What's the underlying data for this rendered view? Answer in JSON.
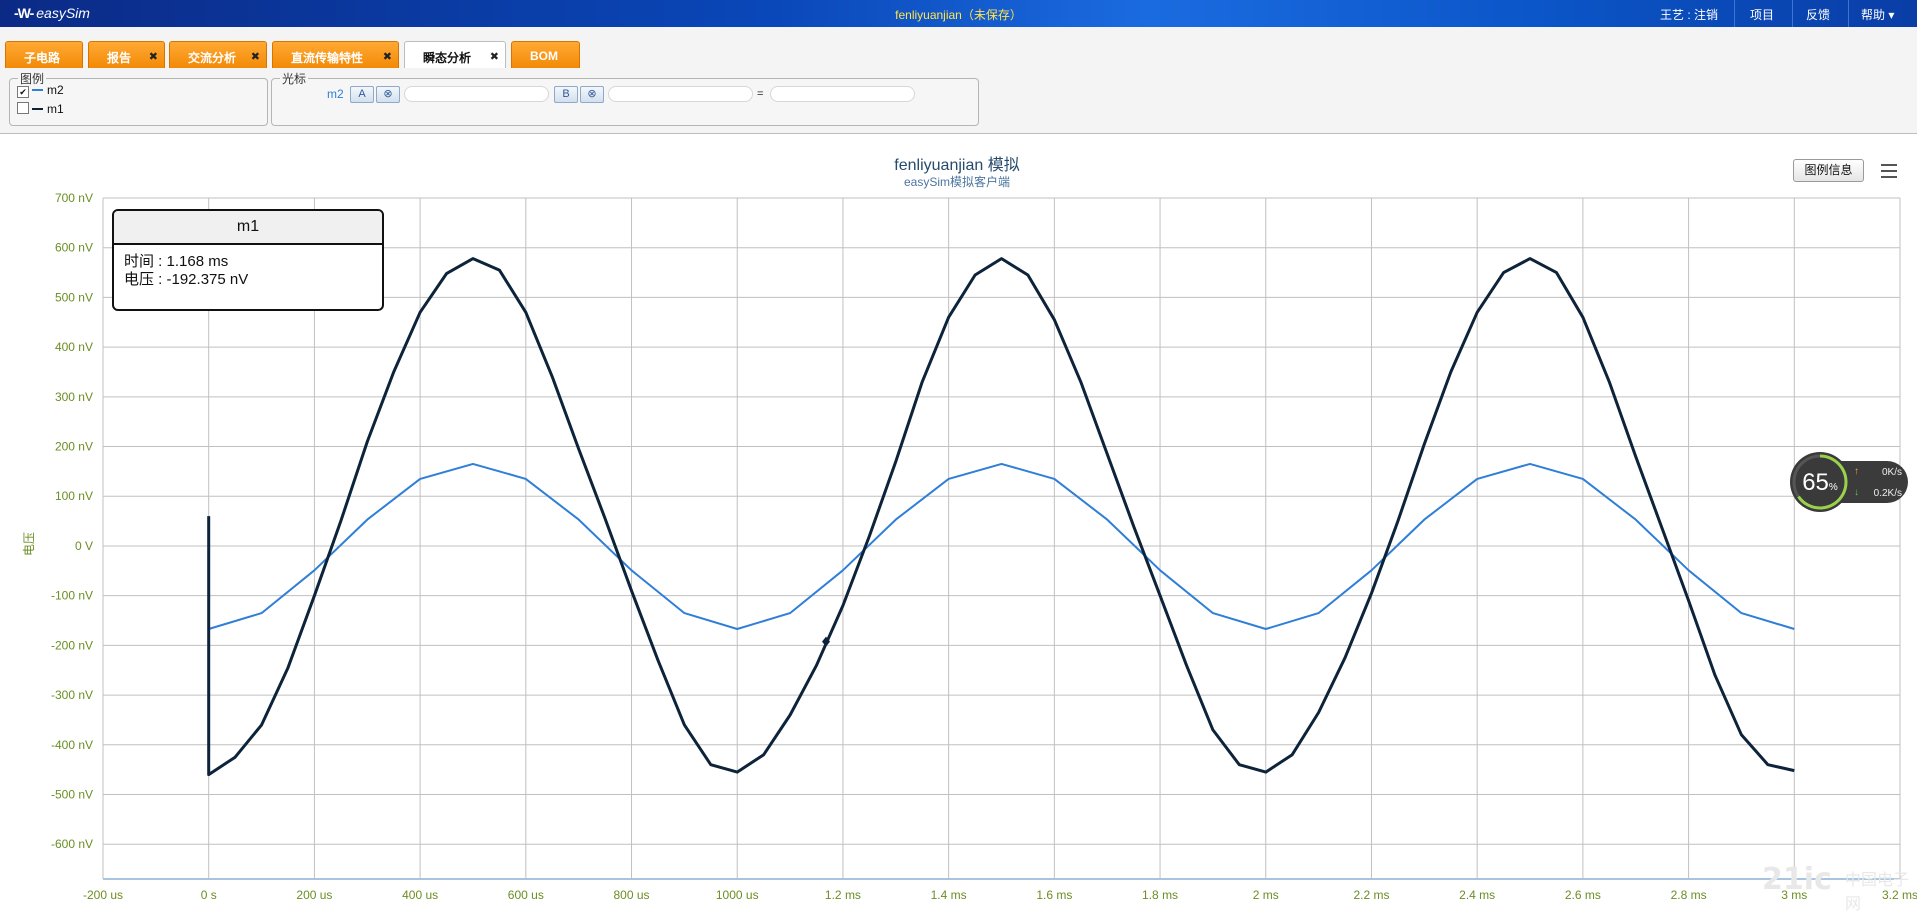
{
  "app": {
    "logo_mark": "-W-",
    "logo_text": "easySim",
    "doc_title": "fenliyuanjian（未保存）",
    "user_logout": "王艺 : 注销",
    "menu_project": "项目",
    "menu_feedback": "反馈",
    "menu_help": "帮助"
  },
  "tabs": [
    {
      "label": "子电路",
      "closable": false,
      "active": false
    },
    {
      "label": "报告",
      "closable": true,
      "active": false
    },
    {
      "label": "交流分析",
      "closable": true,
      "active": false
    },
    {
      "label": "直流传输特性",
      "closable": true,
      "active": false
    },
    {
      "label": "瞬态分析",
      "closable": true,
      "active": true
    },
    {
      "label": "BOM",
      "closable": false,
      "active": false
    }
  ],
  "legend_panel": {
    "title": "图例",
    "items": [
      {
        "label": "m2",
        "checked": true,
        "color": "#2f7ed8"
      },
      {
        "label": "m1",
        "checked": false,
        "color": "#0d233a"
      }
    ]
  },
  "cursor_panel": {
    "title": "光标",
    "series": "m2",
    "btn_a": "A",
    "btn_b": "B",
    "clear_symbol": "⊗",
    "value_a": "",
    "value_b": "",
    "equals": "=",
    "value_diff": ""
  },
  "chart": {
    "title": "fenliyuanjian 模拟",
    "subtitle": "easySim模拟客户端",
    "legend_info_button": "图例信息",
    "y_axis_label": "电压"
  },
  "chart_data": {
    "type": "line",
    "title": "fenliyuanjian 模拟",
    "subtitle": "easySim模拟客户端",
    "ylabel": "电压",
    "xlabel": "",
    "xlim_us": [
      -200,
      3200
    ],
    "ylim_nV": [
      -670,
      700
    ],
    "grid": true,
    "x_tick_labels": [
      "-200 us",
      "0 s",
      "200 us",
      "400 us",
      "600 us",
      "800 us",
      "1000 us",
      "1.2 ms",
      "1.4 ms",
      "1.6 ms",
      "1.8 ms",
      "2 ms",
      "2.2 ms",
      "2.4 ms",
      "2.6 ms",
      "2.8 ms",
      "3 ms",
      "3.2 ms"
    ],
    "y_tick_labels": [
      "700 nV",
      "600 nV",
      "500 nV",
      "400 nV",
      "300 nV",
      "200 nV",
      "100 nV",
      "0 V",
      "-100 nV",
      "-200 nV",
      "-300 nV",
      "-400 nV",
      "-500 nV",
      "-600 nV"
    ],
    "series": [
      {
        "name": "m2",
        "color": "#2f7ed8",
        "x_us": [
          0,
          100,
          200,
          300,
          400,
          500,
          600,
          700,
          800,
          900,
          1000,
          1100,
          1200,
          1300,
          1400,
          1500,
          1600,
          1700,
          1800,
          1900,
          2000,
          2100,
          2200,
          2300,
          2400,
          2500,
          2600,
          2700,
          2800,
          2900,
          3000
        ],
        "y_nV": [
          -167,
          -135,
          -49,
          53,
          135,
          165,
          135,
          53,
          -49,
          -135,
          -167,
          -135,
          -49,
          53,
          135,
          165,
          135,
          53,
          -49,
          -135,
          -167,
          -135,
          -49,
          53,
          135,
          165,
          135,
          53,
          -49,
          -135,
          -167
        ]
      },
      {
        "name": "m1",
        "color": "#0d233a",
        "x_us": [
          0,
          0,
          50,
          100,
          150,
          200,
          250,
          300,
          350,
          400,
          450,
          500,
          550,
          600,
          650,
          700,
          750,
          800,
          850,
          900,
          950,
          1000,
          1050,
          1100,
          1150,
          1200,
          1250,
          1300,
          1350,
          1400,
          1450,
          1500,
          1550,
          1600,
          1650,
          1700,
          1750,
          1800,
          1850,
          1900,
          1950,
          2000,
          2050,
          2100,
          2150,
          2200,
          2250,
          2300,
          2350,
          2400,
          2450,
          2500,
          2550,
          2600,
          2650,
          2700,
          2750,
          2800,
          2850,
          2900,
          2950,
          3000
        ],
        "y_nV": [
          60,
          -460,
          -425,
          -360,
          -245,
          -100,
          50,
          210,
          350,
          470,
          548,
          578,
          555,
          470,
          340,
          195,
          55,
          -90,
          -230,
          -360,
          -440,
          -455,
          -420,
          -340,
          -240,
          -120,
          20,
          170,
          330,
          460,
          545,
          578,
          545,
          455,
          330,
          185,
          40,
          -100,
          -240,
          -370,
          -440,
          -455,
          -420,
          -335,
          -225,
          -95,
          50,
          205,
          350,
          470,
          550,
          578,
          550,
          460,
          330,
          180,
          35,
          -110,
          -260,
          -380,
          -440,
          -452
        ]
      }
    ],
    "tooltip": {
      "series": "m1",
      "time_label": "时间",
      "time_value": "1.168 ms",
      "voltage_label": "电压",
      "voltage_value": "-192.375 nV",
      "marker_x_us": 1168,
      "marker_y_nV": -192.375
    }
  },
  "tooltip_text": {
    "header": "m1",
    "time_line": "时间 : 1.168 ms",
    "voltage_line": "电压 : -192.375 nV"
  },
  "speed_widget": {
    "percent": "65",
    "percent_unit": "%",
    "upload": "0K/s",
    "download": "0.2K/s"
  },
  "watermark": {
    "text": "21ic",
    "text2": "中国电子网"
  }
}
